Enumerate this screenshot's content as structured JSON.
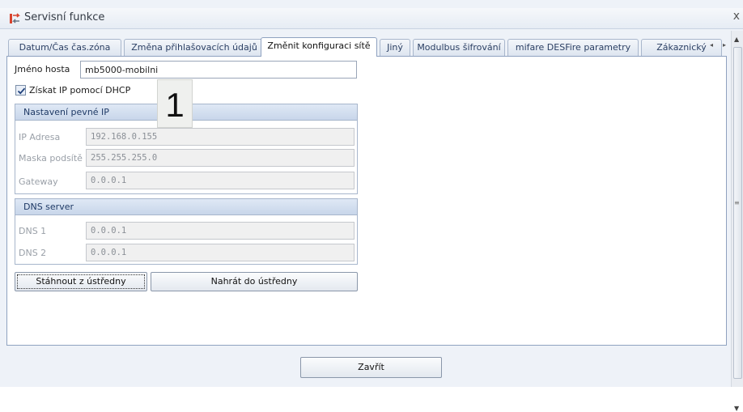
{
  "window": {
    "title": "Servisní funkce",
    "close_glyph": "x"
  },
  "tabs": [
    {
      "label": "Datum/Čas čas.zóna",
      "active": false
    },
    {
      "label": "Změna přihlašovacích údajů",
      "active": false
    },
    {
      "label": "Změnit konfiguraci sítě",
      "active": true
    },
    {
      "label": "Jiný",
      "active": false
    },
    {
      "label": "Modulbus šifrování",
      "active": false
    },
    {
      "label": "mifare DESFire parametry",
      "active": false
    },
    {
      "label": "Zákaznický",
      "active": false
    }
  ],
  "tab_scroll": {
    "left_glyph": "◂",
    "right_glyph": "▸"
  },
  "hostname": {
    "label": "Jméno hosta",
    "value": "mb5000-mobilni"
  },
  "dhcp": {
    "label": "Získat IP pomocí DHCP",
    "checked": true
  },
  "static_ip": {
    "title": "Nastavení pevné IP",
    "fields": [
      {
        "label": "IP Adresa",
        "value": "192.168.0.155"
      },
      {
        "label": "Maska podsítě",
        "value": "255.255.255.0"
      },
      {
        "label": "Gateway",
        "value": "0.0.0.1"
      }
    ]
  },
  "dns": {
    "title": "DNS server",
    "fields": [
      {
        "label": "DNS 1",
        "value": "0.0.0.1"
      },
      {
        "label": "DNS 2",
        "value": "0.0.0.1"
      }
    ]
  },
  "badge": {
    "text": "1"
  },
  "buttons": {
    "download": "Stáhnout z ústředny",
    "upload": "Nahrát do ústředny",
    "close": "Zavřít"
  },
  "icons": {
    "title_icon": "service-arrows-icon",
    "checkbox_mark": "checkmark-icon",
    "scroll_up": "arrow-up-icon",
    "scroll_down": "arrow-down-icon"
  },
  "colors": {
    "accent": "#c8d6ea",
    "group_title": "#1f3a66",
    "title_icon": "#d8432e"
  }
}
